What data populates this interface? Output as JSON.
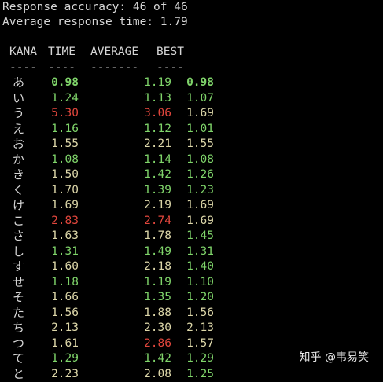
{
  "summary": {
    "accuracy": "Response accuracy: 46 of 46",
    "avg_time": "Average response time: 1.79"
  },
  "table": {
    "headers": {
      "kana": "KANA",
      "time": "TIME",
      "average": "AVERAGE",
      "best": "BEST"
    },
    "dashes": {
      "kana": "----",
      "time": "----",
      "average": "-------",
      "best": "----"
    },
    "rows": [
      {
        "kana": "あ",
        "time": "0.98",
        "time_c": "g",
        "time_b": true,
        "avg": "1.19",
        "avg_c": "g",
        "best": "0.98",
        "best_c": "g",
        "best_b": true
      },
      {
        "kana": "い",
        "time": "1.24",
        "time_c": "g",
        "avg": "1.13",
        "avg_c": "g",
        "best": "1.07",
        "best_c": "g"
      },
      {
        "kana": "う",
        "time": "5.30",
        "time_c": "r",
        "avg": "3.06",
        "avg_c": "r",
        "best": "1.69",
        "best_c": "y"
      },
      {
        "kana": "え",
        "time": "1.16",
        "time_c": "g",
        "avg": "1.12",
        "avg_c": "g",
        "best": "1.01",
        "best_c": "g"
      },
      {
        "kana": "お",
        "time": "1.55",
        "time_c": "y",
        "avg": "2.21",
        "avg_c": "y",
        "best": "1.55",
        "best_c": "y"
      },
      {
        "kana": "か",
        "time": "1.08",
        "time_c": "g",
        "avg": "1.14",
        "avg_c": "g",
        "best": "1.08",
        "best_c": "g"
      },
      {
        "kana": "き",
        "time": "1.50",
        "time_c": "y",
        "avg": "1.42",
        "avg_c": "g",
        "best": "1.26",
        "best_c": "g"
      },
      {
        "kana": "く",
        "time": "1.70",
        "time_c": "y",
        "avg": "1.39",
        "avg_c": "g",
        "best": "1.23",
        "best_c": "g"
      },
      {
        "kana": "け",
        "time": "1.69",
        "time_c": "y",
        "avg": "2.19",
        "avg_c": "y",
        "best": "1.69",
        "best_c": "y"
      },
      {
        "kana": "こ",
        "time": "2.83",
        "time_c": "r",
        "avg": "2.74",
        "avg_c": "r",
        "best": "1.69",
        "best_c": "y"
      },
      {
        "kana": "さ",
        "time": "1.63",
        "time_c": "y",
        "avg": "1.78",
        "avg_c": "y",
        "best": "1.45",
        "best_c": "g"
      },
      {
        "kana": "し",
        "time": "1.31",
        "time_c": "g",
        "avg": "1.49",
        "avg_c": "g",
        "best": "1.31",
        "best_c": "g"
      },
      {
        "kana": "す",
        "time": "1.60",
        "time_c": "y",
        "avg": "2.18",
        "avg_c": "y",
        "best": "1.40",
        "best_c": "g"
      },
      {
        "kana": "せ",
        "time": "1.18",
        "time_c": "g",
        "avg": "1.19",
        "avg_c": "g",
        "best": "1.10",
        "best_c": "g"
      },
      {
        "kana": "そ",
        "time": "1.66",
        "time_c": "y",
        "avg": "1.35",
        "avg_c": "g",
        "best": "1.20",
        "best_c": "g"
      },
      {
        "kana": "た",
        "time": "1.56",
        "time_c": "y",
        "avg": "1.88",
        "avg_c": "y",
        "best": "1.56",
        "best_c": "y"
      },
      {
        "kana": "ち",
        "time": "2.13",
        "time_c": "y",
        "avg": "2.30",
        "avg_c": "y",
        "best": "2.13",
        "best_c": "y"
      },
      {
        "kana": "つ",
        "time": "1.61",
        "time_c": "y",
        "avg": "2.86",
        "avg_c": "r",
        "best": "1.57",
        "best_c": "y"
      },
      {
        "kana": "て",
        "time": "1.29",
        "time_c": "g",
        "avg": "1.42",
        "avg_c": "g",
        "best": "1.29",
        "best_c": "g"
      },
      {
        "kana": "と",
        "time": "2.23",
        "time_c": "y",
        "avg": "2.08",
        "avg_c": "y",
        "best": "1.25",
        "best_c": "g"
      }
    ]
  },
  "colors": {
    "green": "#7fd46a",
    "yellow": "#dcd6a8",
    "red": "#e0463c",
    "background": "#000000"
  },
  "watermark": "知乎 @韦易笑"
}
